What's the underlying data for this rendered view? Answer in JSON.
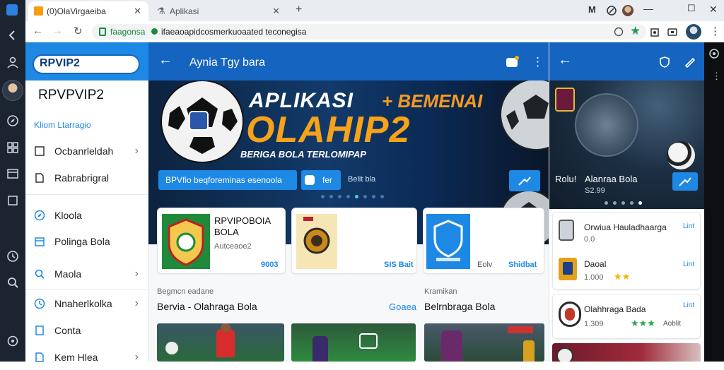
{
  "colors": {
    "primary": "#1565c0",
    "accent": "#1e88e5",
    "link": "#1e88e5",
    "dark": "#1b2430",
    "stars": "#f2b600"
  },
  "browser": {
    "tabs": [
      {
        "title": "(0)OlaVirgaeiba",
        "active": true
      },
      {
        "title": "Aplikasi",
        "active": false
      }
    ],
    "url_domain": "faagonsa",
    "url_path": "ifaeaoapidcosmerkuoaated teconegisa"
  },
  "drawer": {
    "brand": "RPVIP2",
    "brand_big": "RPVPVIP2",
    "section": "Kliom Ltarragio",
    "items": [
      {
        "label": "Ocbanrleldah",
        "icon": "square-icon",
        "chevron": true
      },
      {
        "label": "Rabrabrigral",
        "icon": "file-icon",
        "chevron": false
      },
      {
        "label": "Kloola",
        "icon": "compass-icon",
        "chevron": false
      },
      {
        "label": "Polinga Bola",
        "icon": "calendar-icon",
        "chevron": false
      },
      {
        "label": "Maola",
        "icon": "search-icon",
        "chevron": true
      },
      {
        "label": "Nnaherlkolka",
        "icon": "clock-icon",
        "chevron": true
      },
      {
        "label": "Conta",
        "icon": "document-icon",
        "chevron": false
      },
      {
        "label": "Kem Hlea",
        "icon": "file-icon",
        "chevron": true
      }
    ]
  },
  "main": {
    "app_title": "Aynia Tgy bara",
    "hero": {
      "line1": "APLIKASI",
      "plus": "+ BEMENAI",
      "line2": "OLAHIP2",
      "tagline": "BERIGA BOLA TERLOMIPAP",
      "cta": "BPVfio beqforeminas esenoola",
      "secondary": "fer",
      "secondary_text": "Belit bla"
    },
    "apps": [
      {
        "name": "RPVIPOBOIA BOLA",
        "sub": "Autceaoe2",
        "price": "9003"
      },
      {
        "name": "",
        "sub": "",
        "price": "SIS Bait"
      },
      {
        "name": "",
        "sub": "Eolv",
        "price": "Shidbat"
      }
    ],
    "section_left_small": "Begmcn eadane",
    "section_left_title": "Bervia - Olahraga Bola",
    "section_left_link": "Goaea",
    "section_right_small": "Kramikan",
    "section_right_title": "Belrnbraga Bola"
  },
  "right": {
    "hero_label": "Rolu!",
    "hero_title": "Alanraa Bola",
    "hero_sub": "S2.99",
    "list": [
      {
        "title": "Orwiua Hauladhaarga",
        "value": "0.0",
        "tag": "Lint"
      },
      {
        "title": "Daoal",
        "value": "1.000",
        "tag": "Lint"
      },
      {
        "title": "Olahhraga Bada",
        "value": "1.309",
        "tag": "Lint",
        "extra": "Aoblit"
      }
    ]
  }
}
